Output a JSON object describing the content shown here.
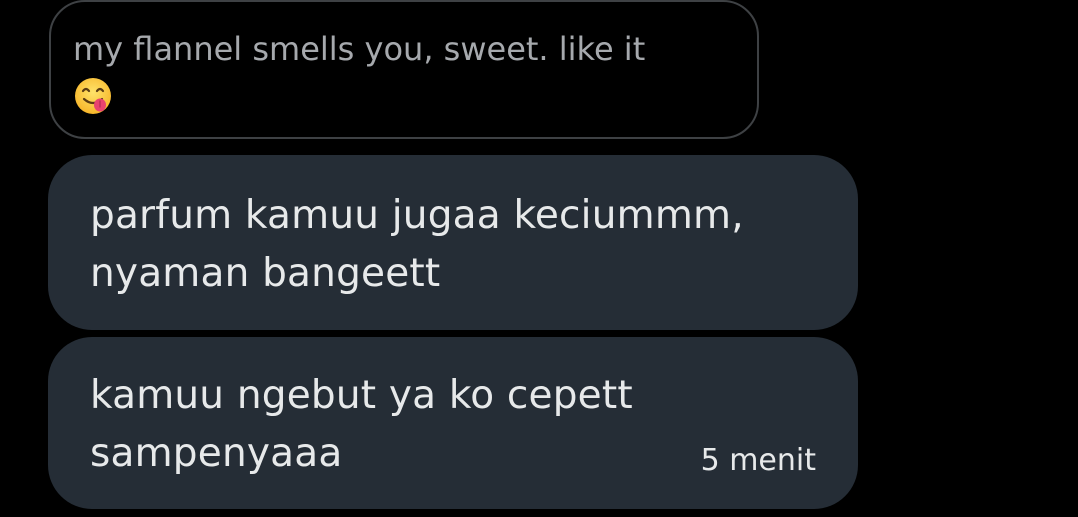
{
  "quoted_reply": {
    "text": "my flannel smells you, sweet. like it",
    "emoji": "face-savoring-food-emoji"
  },
  "messages": [
    {
      "lines": [
        "parfum kamuu jugaa keciummm,",
        "nyaman bangeett"
      ]
    },
    {
      "lines": [
        "kamuu ngebut ya ko cepett",
        "sampenyaaa"
      ],
      "timestamp": "5 menit"
    }
  ],
  "colors": {
    "background": "#000000",
    "bubble": "#252d36",
    "quoted_border": "#3e4144",
    "quoted_text": "#a6a9ad",
    "message_text": "#e7e9ea"
  }
}
